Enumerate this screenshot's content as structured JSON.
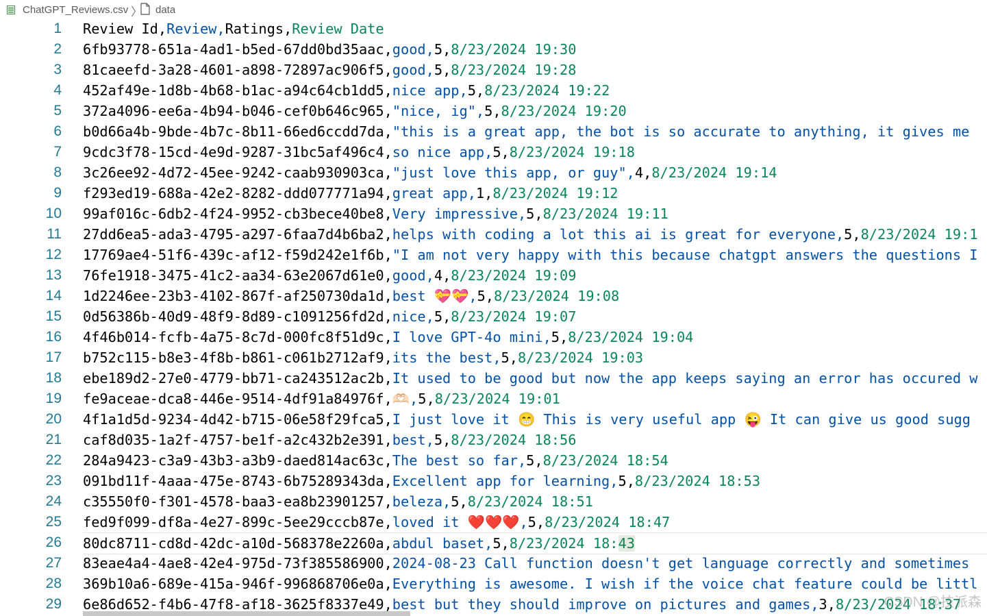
{
  "breadcrumb": {
    "file": "ChatGPT_Reviews.csv",
    "separator": "〉",
    "folder": "data"
  },
  "colors": {
    "line_number": "#237893",
    "review_text": "#0451a5",
    "date_text": "#098658",
    "plain_text": "#000000"
  },
  "lines": [
    {
      "n": "1",
      "segments": [
        {
          "t": "Review Id,",
          "c": "plain"
        },
        {
          "t": "Review,",
          "c": "review"
        },
        {
          "t": "Ratings,",
          "c": "plain"
        },
        {
          "t": "Review Date",
          "c": "date"
        }
      ]
    },
    {
      "n": "2",
      "segments": [
        {
          "t": "6fb93778-651a-4ad1-b5ed-67dd0bd35aac,",
          "c": "plain"
        },
        {
          "t": "good,",
          "c": "review"
        },
        {
          "t": "5,",
          "c": "plain"
        },
        {
          "t": "8/23/2024 19:30",
          "c": "date"
        }
      ]
    },
    {
      "n": "3",
      "segments": [
        {
          "t": "81caeefd-3a28-4601-a898-72897ac906f5,",
          "c": "plain"
        },
        {
          "t": "good,",
          "c": "review"
        },
        {
          "t": "5,",
          "c": "plain"
        },
        {
          "t": "8/23/2024 19:28",
          "c": "date"
        }
      ]
    },
    {
      "n": "4",
      "segments": [
        {
          "t": "452af49e-1d8b-4b68-b1ac-a94c64cb1dd5,",
          "c": "plain"
        },
        {
          "t": "nice app,",
          "c": "review"
        },
        {
          "t": "5,",
          "c": "plain"
        },
        {
          "t": "8/23/2024 19:22",
          "c": "date"
        }
      ]
    },
    {
      "n": "5",
      "segments": [
        {
          "t": "372a4096-ee6a-4b94-b046-cef0b646c965,",
          "c": "plain"
        },
        {
          "t": "\"nice, ig\",",
          "c": "review"
        },
        {
          "t": "5,",
          "c": "plain"
        },
        {
          "t": "8/23/2024 19:20",
          "c": "date"
        }
      ]
    },
    {
      "n": "6",
      "segments": [
        {
          "t": "b0d66a4b-9bde-4b7c-8b11-66ed6ccdd7da,",
          "c": "plain"
        },
        {
          "t": "\"this is a great app, the bot is so accurate to anything, it gives me",
          "c": "review"
        }
      ]
    },
    {
      "n": "7",
      "segments": [
        {
          "t": "9cdc3f78-15cd-4e9d-9287-31bc5af496c4,",
          "c": "plain"
        },
        {
          "t": "so nice app,",
          "c": "review"
        },
        {
          "t": "5,",
          "c": "plain"
        },
        {
          "t": "8/23/2024 19:18",
          "c": "date"
        }
      ]
    },
    {
      "n": "8",
      "segments": [
        {
          "t": "3c26ee92-4d72-45ee-9242-caab930903ca,",
          "c": "plain"
        },
        {
          "t": "\"just love this app, or guy\",",
          "c": "review"
        },
        {
          "t": "4,",
          "c": "plain"
        },
        {
          "t": "8/23/2024 19:14",
          "c": "date"
        }
      ]
    },
    {
      "n": "9",
      "segments": [
        {
          "t": "f293ed19-688a-42e2-8282-ddd077771a94,",
          "c": "plain"
        },
        {
          "t": "great app,",
          "c": "review"
        },
        {
          "t": "1,",
          "c": "plain"
        },
        {
          "t": "8/23/2024 19:12",
          "c": "date"
        }
      ]
    },
    {
      "n": "10",
      "segments": [
        {
          "t": "99af016c-6db2-4f24-9952-cb3bece40be8,",
          "c": "plain"
        },
        {
          "t": "Very impressive,",
          "c": "review"
        },
        {
          "t": "5,",
          "c": "plain"
        },
        {
          "t": "8/23/2024 19:11",
          "c": "date"
        }
      ]
    },
    {
      "n": "11",
      "segments": [
        {
          "t": "27dd6ea5-ada3-4795-a297-6faa7d4b6ba2,",
          "c": "plain"
        },
        {
          "t": "helps with coding a lot this ai is great for everyone,",
          "c": "review"
        },
        {
          "t": "5,",
          "c": "plain"
        },
        {
          "t": "8/23/2024 19:1",
          "c": "date"
        }
      ]
    },
    {
      "n": "12",
      "segments": [
        {
          "t": "17769ae4-51f6-439c-af12-f59d242e1f6b,",
          "c": "plain"
        },
        {
          "t": "\"I am not very happy with this because chatgpt answers the questions I",
          "c": "review"
        }
      ]
    },
    {
      "n": "13",
      "segments": [
        {
          "t": "76fe1918-3475-41c2-aa34-63e2067d61e0,",
          "c": "plain"
        },
        {
          "t": "good,",
          "c": "review"
        },
        {
          "t": "4,",
          "c": "plain"
        },
        {
          "t": "8/23/2024 19:09",
          "c": "date"
        }
      ]
    },
    {
      "n": "14",
      "segments": [
        {
          "t": "1d2246ee-23b3-4102-867f-af250730da1d,",
          "c": "plain"
        },
        {
          "t": "best 💝💝,",
          "c": "review"
        },
        {
          "t": "5,",
          "c": "plain"
        },
        {
          "t": "8/23/2024 19:08",
          "c": "date"
        }
      ]
    },
    {
      "n": "15",
      "segments": [
        {
          "t": "0d56386b-40d9-48f9-8d89-c1091256fd2d,",
          "c": "plain"
        },
        {
          "t": "nice,",
          "c": "review"
        },
        {
          "t": "5,",
          "c": "plain"
        },
        {
          "t": "8/23/2024 19:07",
          "c": "date"
        }
      ]
    },
    {
      "n": "16",
      "segments": [
        {
          "t": "4f46b014-fcfb-4a75-8c7d-000fc8f51d9c,",
          "c": "plain"
        },
        {
          "t": "I love GPT-4o mini,",
          "c": "review"
        },
        {
          "t": "5,",
          "c": "plain"
        },
        {
          "t": "8/23/2024 19:04",
          "c": "date"
        }
      ]
    },
    {
      "n": "17",
      "segments": [
        {
          "t": "b752c115-b8e3-4f8b-b861-c061b2712af9,",
          "c": "plain"
        },
        {
          "t": "its the best,",
          "c": "review"
        },
        {
          "t": "5,",
          "c": "plain"
        },
        {
          "t": "8/23/2024 19:03",
          "c": "date"
        }
      ]
    },
    {
      "n": "18",
      "segments": [
        {
          "t": "ebe189d2-27e0-4779-bb71-ca243512ac2b,",
          "c": "plain"
        },
        {
          "t": "It used to be good but now the app keeps saying an error has occured w",
          "c": "review"
        }
      ]
    },
    {
      "n": "19",
      "segments": [
        {
          "t": "fe9aceae-dca8-446e-9514-4df91a84976f,",
          "c": "plain"
        },
        {
          "t": "🫶🏻,",
          "c": "review"
        },
        {
          "t": "5,",
          "c": "plain"
        },
        {
          "t": "8/23/2024 19:01",
          "c": "date"
        }
      ]
    },
    {
      "n": "20",
      "segments": [
        {
          "t": "4f1a1d5d-9234-4d42-b715-06e58f29fca5,",
          "c": "plain"
        },
        {
          "t": "I just love it 😁 This is very useful app 😜 It can give us good sugg",
          "c": "review"
        }
      ]
    },
    {
      "n": "21",
      "segments": [
        {
          "t": "caf8d035-1a2f-4757-be1f-a2c432b2e391,",
          "c": "plain"
        },
        {
          "t": "best,",
          "c": "review"
        },
        {
          "t": "5,",
          "c": "plain"
        },
        {
          "t": "8/23/2024 18:56",
          "c": "date"
        }
      ]
    },
    {
      "n": "22",
      "segments": [
        {
          "t": "284a9423-c3a9-43b3-a3b9-daed814ac63c,",
          "c": "plain"
        },
        {
          "t": "The best so far,",
          "c": "review"
        },
        {
          "t": "5,",
          "c": "plain"
        },
        {
          "t": "8/23/2024 18:54",
          "c": "date"
        }
      ]
    },
    {
      "n": "23",
      "segments": [
        {
          "t": "091bd11f-4aaa-475e-8743-6b75289343da,",
          "c": "plain"
        },
        {
          "t": "Excellent app for learning,",
          "c": "review"
        },
        {
          "t": "5,",
          "c": "plain"
        },
        {
          "t": "8/23/2024 18:53",
          "c": "date"
        }
      ]
    },
    {
      "n": "24",
      "segments": [
        {
          "t": "c35550f0-f301-4578-baa3-ea8b23901257,",
          "c": "plain"
        },
        {
          "t": "beleza,",
          "c": "review"
        },
        {
          "t": "5,",
          "c": "plain"
        },
        {
          "t": "8/23/2024 18:51",
          "c": "date"
        }
      ]
    },
    {
      "n": "25",
      "segments": [
        {
          "t": "fed9f099-df8a-4e27-899c-5ee29cccb87e,",
          "c": "plain"
        },
        {
          "t": "loved it ❤️❤️❤️,",
          "c": "review"
        },
        {
          "t": "5,",
          "c": "plain"
        },
        {
          "t": "8/23/2024 18:47",
          "c": "date"
        }
      ]
    },
    {
      "n": "26",
      "current": true,
      "segments": [
        {
          "t": "80dc8711-cd8d-42dc-a10d-568378e2260a,",
          "c": "plain"
        },
        {
          "t": "abdul baset,",
          "c": "review"
        },
        {
          "t": "5,",
          "c": "plain"
        },
        {
          "t": "8/23/2024 18:",
          "c": "date"
        },
        {
          "t": "43",
          "c": "date",
          "sel": true
        }
      ]
    },
    {
      "n": "27",
      "segments": [
        {
          "t": "83eae4a4-4ae8-42e4-975d-73f385586900,",
          "c": "plain"
        },
        {
          "t": "2024-08-23 Call function doesn't get language correctly and sometimes",
          "c": "review"
        }
      ]
    },
    {
      "n": "28",
      "segments": [
        {
          "t": "369b10a6-689e-415a-946f-996868706e0a,",
          "c": "plain"
        },
        {
          "t": "Everything is awesome. I wish if the voice chat feature could be littl",
          "c": "review"
        }
      ]
    },
    {
      "n": "29",
      "segments": [
        {
          "t": "6e86d652-f4b6-47f8-af18-3625f8337e49,",
          "c": "plain"
        },
        {
          "t": "best but they should improve on pictures and games,",
          "c": "review"
        },
        {
          "t": "3,",
          "c": "plain"
        },
        {
          "t": "8/23/2024 18:37",
          "c": "date"
        }
      ]
    }
  ],
  "watermark": "CSDN @技派森"
}
